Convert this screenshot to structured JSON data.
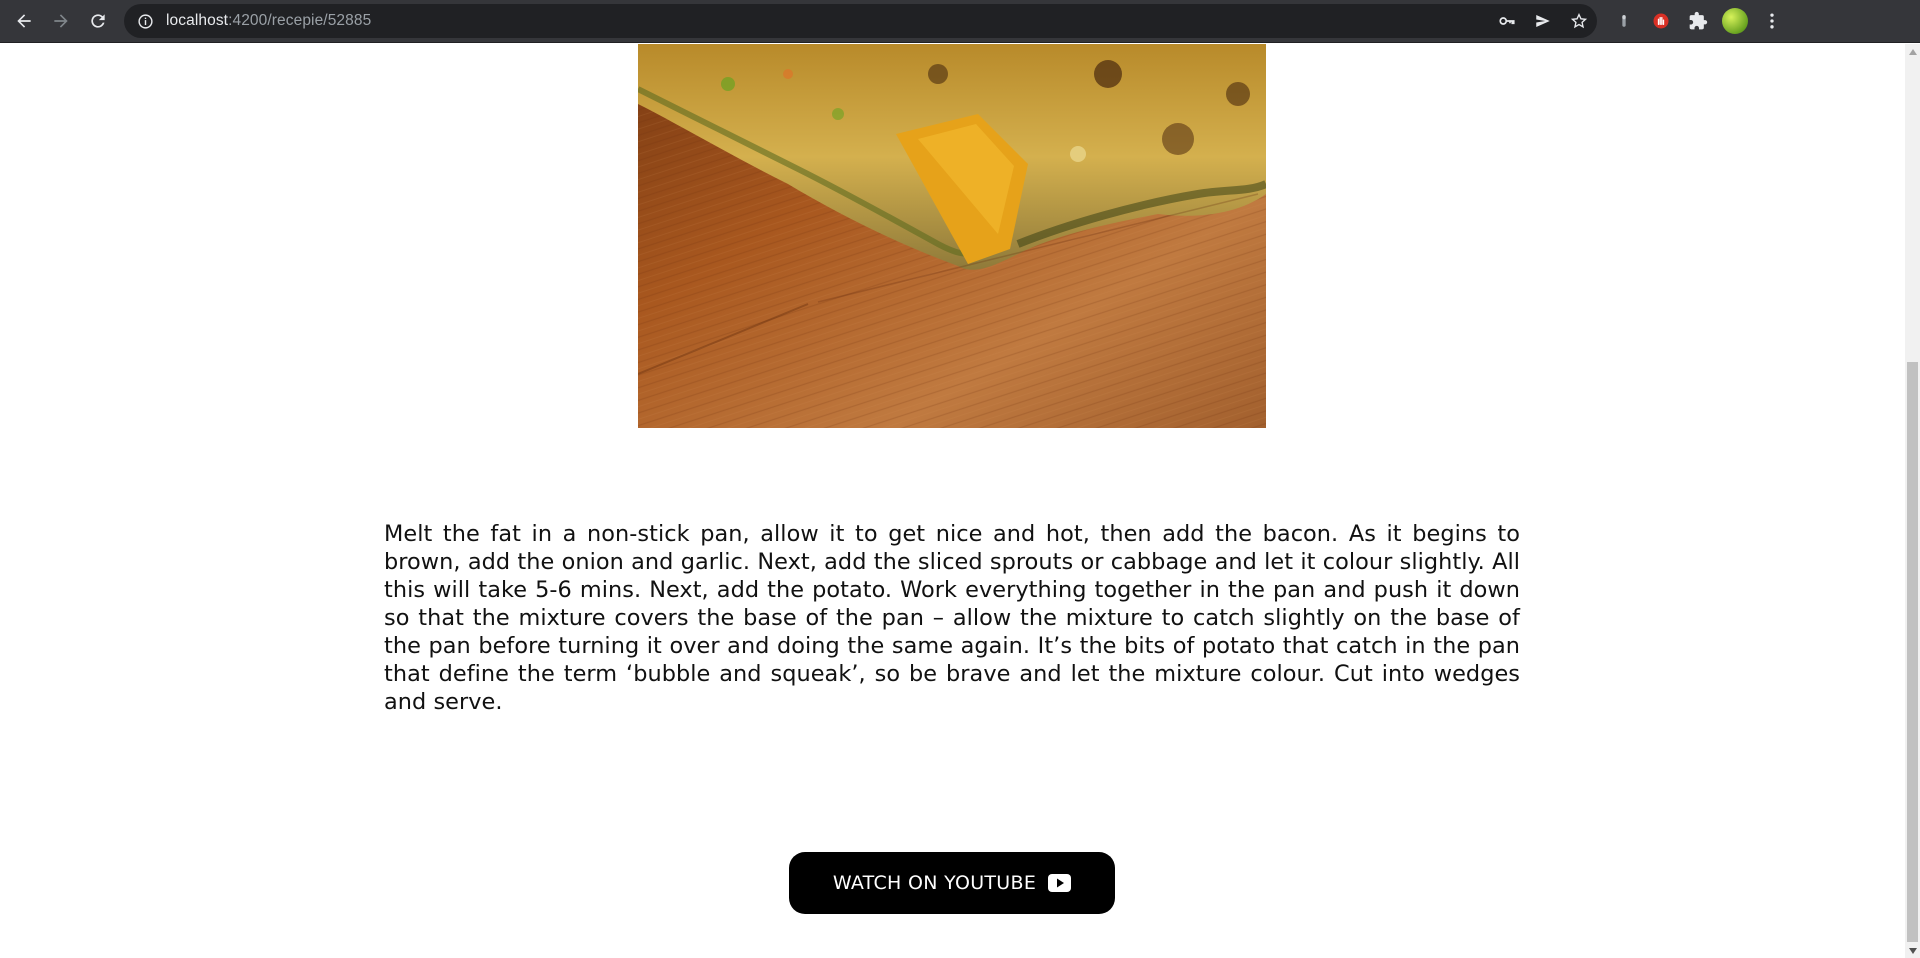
{
  "browser": {
    "url_host": "localhost",
    "url_path": ":4200/recepie/52885",
    "icons": [
      "back-arrow-icon",
      "forward-arrow-icon",
      "reload-icon",
      "site-info-icon",
      "key-icon",
      "send-icon",
      "star-icon",
      "extension-icon",
      "puzzle-icon",
      "avatar",
      "menu-icon"
    ]
  },
  "recipe": {
    "image_alt": "Bubble and squeak",
    "instructions": "Melt the fat in a non-stick pan, allow it to get nice and hot, then add the bacon. As it begins to brown, add the onion and garlic. Next, add the sliced sprouts or cabbage and let it colour slightly. All this will take 5-6 mins. Next, add the potato. Work everything together in the pan and push it down so that the mixture covers the base of the pan – allow the mixture to catch slightly on the base of the pan before turning it over and doing the same again. It’s the bits of potato that catch in the pan that define the term ‘bubble and squeak’, so be brave and let the mixture colour. Cut into wedges and serve.",
    "youtube_label": "WATCH ON YOUTUBE"
  },
  "colors": {
    "chrome_bg": "#35363a",
    "omnibox_bg": "#202124",
    "button_bg": "#000000",
    "text": "#111111"
  }
}
